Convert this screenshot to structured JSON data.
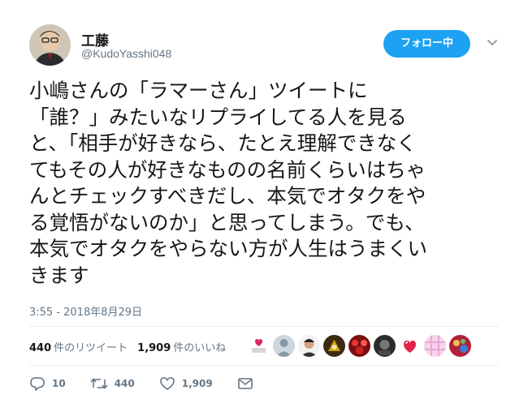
{
  "author": {
    "display_name": "工藤",
    "handle": "@KudoYasshi048"
  },
  "follow_button_label": "フォロー中",
  "tweet": {
    "lines": [
      "小嶋さんの「ラマーさん」ツイートに",
      "「誰？」みたいなリプライしてる人を見る",
      "と、「相手が好きなら、たとえ理解できなく",
      "てもその人が好きなものの名前くらいはちゃ",
      "んとチェックすべきだし、本気でオタクをや",
      "る覚悟がないのか」と思ってしまう。でも、",
      "本気でオタクをやらない方が人生はうまくい",
      "きます"
    ],
    "timestamp": "3:55 - 2018年8月29日"
  },
  "stats": {
    "retweets_count": "440",
    "retweets_label": "件のリツイート",
    "likes_count": "1,909",
    "likes_label": "件のいいね"
  },
  "liker_avatars": [
    "liker-1",
    "liker-2",
    "liker-3",
    "liker-4",
    "liker-5",
    "liker-6",
    "liker-7",
    "liker-8",
    "liker-9"
  ],
  "actions": {
    "reply_count": "10",
    "retweet_count": "440",
    "like_count": "1,909"
  },
  "colors": {
    "accent": "#1da1f2",
    "muted": "#657786",
    "text": "#14171a",
    "divider": "#e6ecf0"
  }
}
